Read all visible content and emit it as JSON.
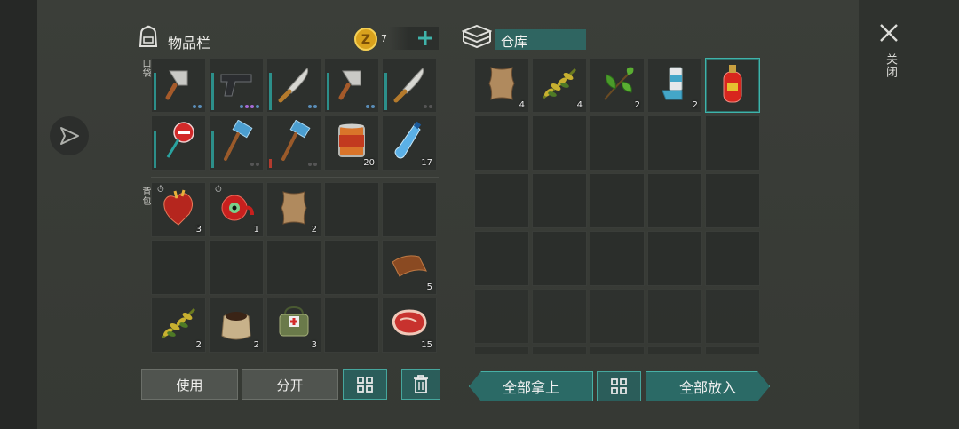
{
  "inventory": {
    "title": "物品栏",
    "coin_count": "7",
    "pocket_label": "口袋",
    "backpack_label": "背包",
    "pocket_slots": [
      {
        "item": "cleaver-icon",
        "dur": "teal",
        "dots": [
          "b",
          "b"
        ]
      },
      {
        "item": "pistol-icon",
        "dur": "teal",
        "dots": [
          "b",
          "p",
          "p",
          "b"
        ]
      },
      {
        "item": "machete-icon",
        "dur": "teal",
        "dots": [
          "b",
          "b"
        ]
      },
      {
        "item": "cleaver-icon",
        "dur": "teal",
        "dots": [
          "b",
          "b"
        ]
      },
      {
        "item": "machete-icon",
        "dur": "teal",
        "dots": [
          "g",
          "g"
        ]
      },
      {
        "item": "stop-sign-icon",
        "dur": "teal"
      },
      {
        "item": "sledgehammer-icon",
        "dur": "teal",
        "dots": [
          "g",
          "g"
        ]
      },
      {
        "item": "sledgehammer-icon",
        "dur": "red",
        "dots": [
          "g",
          "g"
        ]
      },
      {
        "item": "canned-food-icon",
        "count": "20"
      },
      {
        "item": "water-bottle-icon",
        "count": "17"
      }
    ],
    "backpack_slots": [
      {
        "item": "heart-icon",
        "count": "3",
        "timer": true
      },
      {
        "item": "eyeball-meat-icon",
        "count": "1",
        "timer": true
      },
      {
        "item": "leather-hide-icon",
        "count": "2"
      },
      {
        "item": ""
      },
      {
        "item": ""
      },
      {
        "item": ""
      },
      {
        "item": ""
      },
      {
        "item": ""
      },
      {
        "item": ""
      },
      {
        "item": "leather-strip-icon",
        "count": "5"
      },
      {
        "item": "plant-fiber-icon",
        "count": "2"
      },
      {
        "item": "seed-sack-icon",
        "count": "2"
      },
      {
        "item": "medkit-bag-icon",
        "count": "3"
      },
      {
        "item": ""
      },
      {
        "item": "raw-meat-icon",
        "count": "15"
      }
    ],
    "use_label": "使用",
    "split_label": "分开"
  },
  "warehouse": {
    "title": "仓库",
    "slots": [
      {
        "item": "leather-hide-icon",
        "count": "4"
      },
      {
        "item": "plant-fiber-icon",
        "count": "4"
      },
      {
        "item": "herb-leaf-icon",
        "count": "2"
      },
      {
        "item": "inhaler-icon",
        "count": "2"
      },
      {
        "item": "gas-canister-icon",
        "selected": true
      }
    ],
    "take_all_label": "全部拿上",
    "put_all_label": "全部放入"
  },
  "close_label": "关闭",
  "colors": {
    "accent": "#3fb3aa",
    "panel": "#3b3e39",
    "slot": "#2d302d"
  }
}
